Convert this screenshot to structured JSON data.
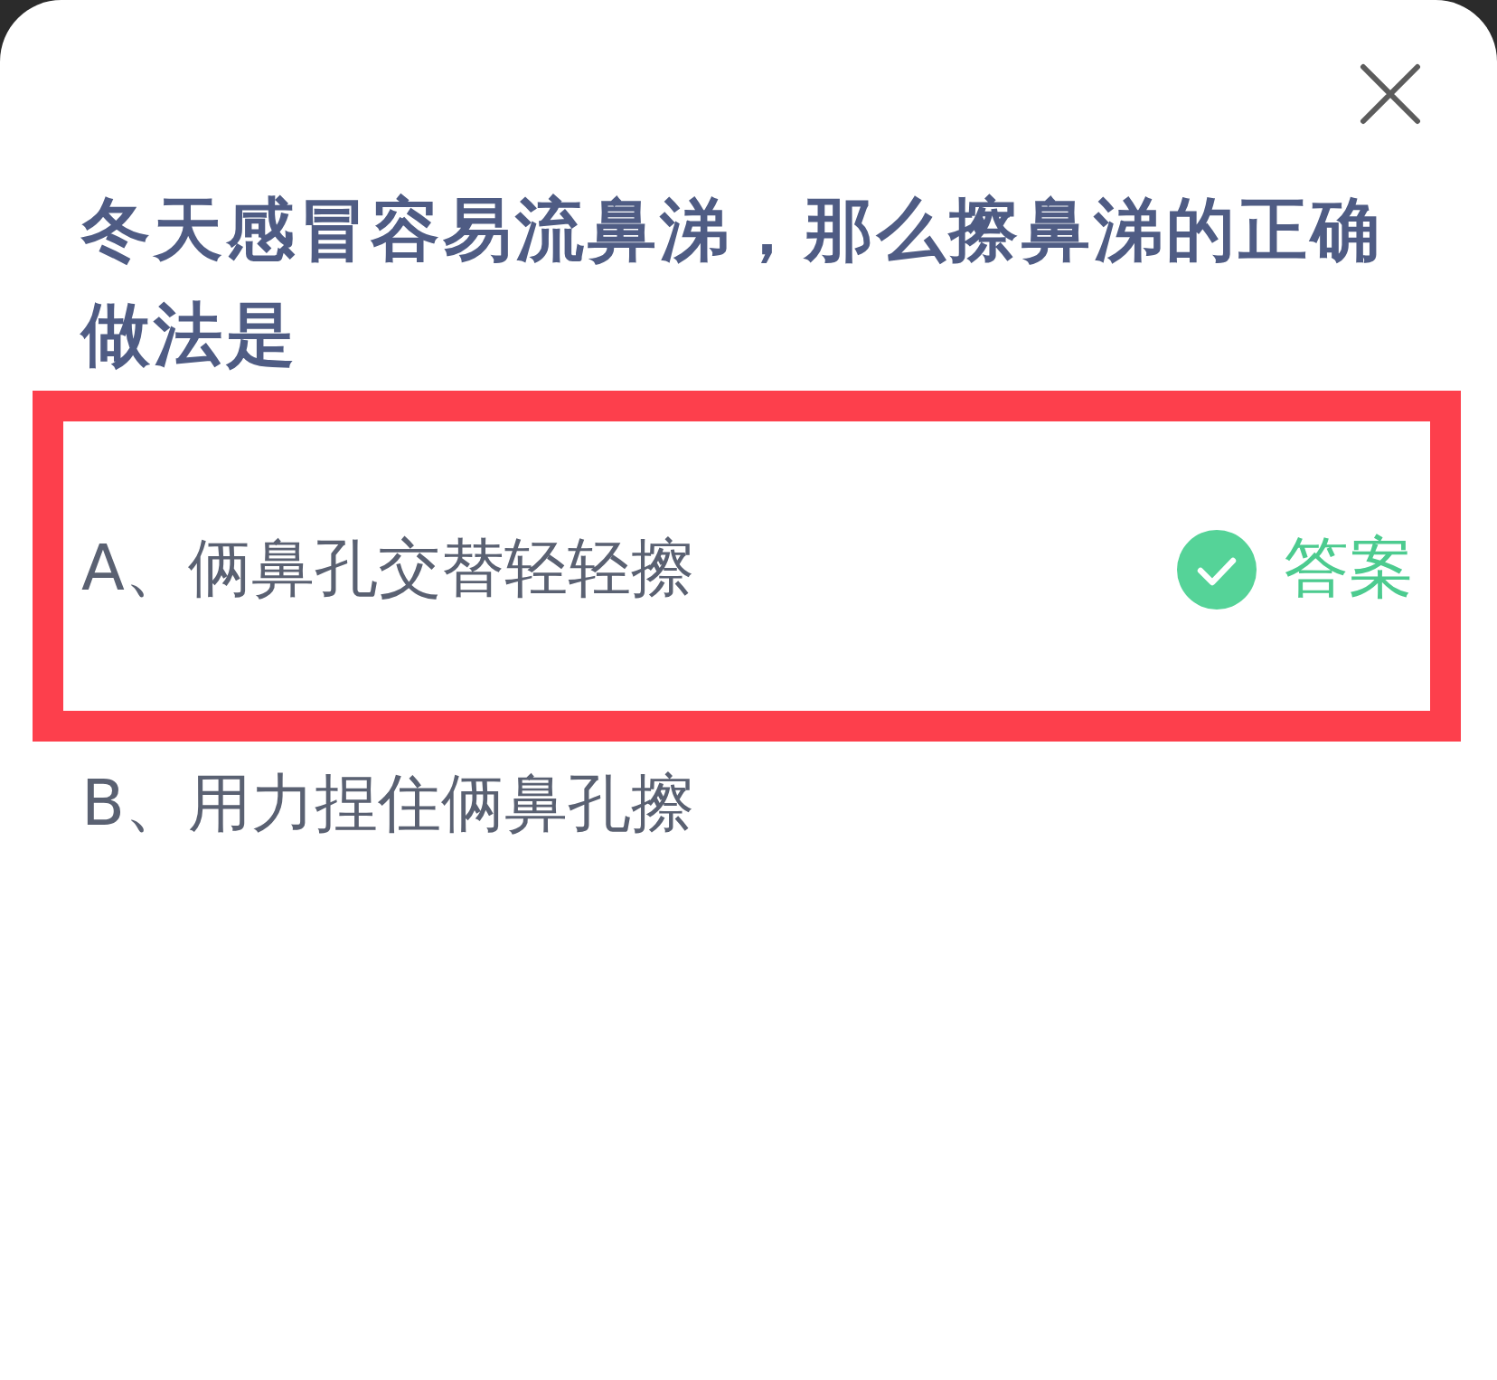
{
  "question": {
    "text": "冬天感冒容易流鼻涕，那么擦鼻涕的正确做法是"
  },
  "options": [
    {
      "text": "A、俩鼻孔交替轻轻擦",
      "highlighted": true,
      "correct": true,
      "answer_label": "答案"
    },
    {
      "text": "B、用力捏住俩鼻孔擦",
      "highlighted": false,
      "correct": false
    }
  ]
}
